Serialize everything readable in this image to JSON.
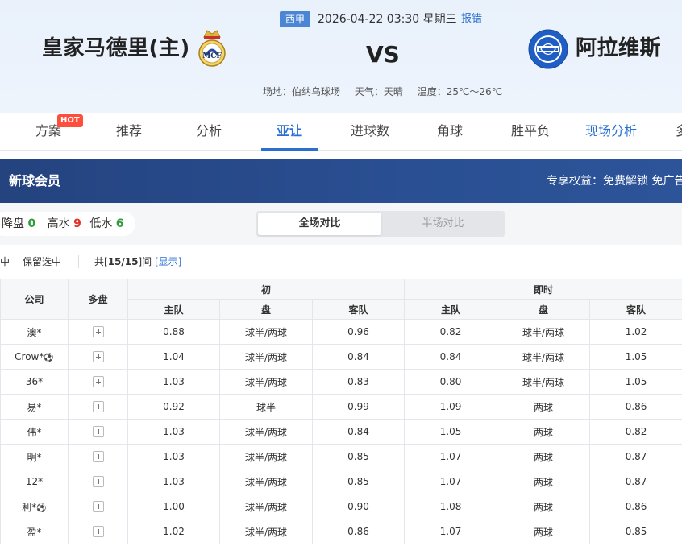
{
  "match": {
    "league": "西甲",
    "time": "2026-04-22 03:30 星期三",
    "report": "报错",
    "home": "皇家马德里(主)",
    "vs": "VS",
    "away": "阿拉维斯",
    "venue": "场地：伯纳乌球场",
    "weather": "天气：天晴",
    "temperature": "温度：25℃～26℃"
  },
  "tabs": [
    {
      "label": "方案"
    },
    {
      "label": "推荐"
    },
    {
      "label": "分析"
    },
    {
      "label": "亚让"
    },
    {
      "label": "进球数"
    },
    {
      "label": "角球"
    },
    {
      "label": "胜平负"
    },
    {
      "label": "现场分析"
    },
    {
      "label": "多"
    }
  ],
  "hot_badge": "HOT",
  "member": {
    "title": "新球会员",
    "benefit": "专享权益：免费解锁 免广告"
  },
  "stats": {
    "down_label": "降盘",
    "down_value": "0",
    "high_label": "高水",
    "high_value": "9",
    "low_label": "低水",
    "low_value": "6"
  },
  "toggle": {
    "full": "全场对比",
    "half": "半场对比"
  },
  "filter": {
    "select_label": "选中",
    "keep_label": "保留选中",
    "total_prefix": "共[",
    "total_value": "15/15",
    "total_suffix": "]间",
    "show_label": "[显示]"
  },
  "table": {
    "headers": {
      "company": "公司",
      "multi": "多盘",
      "initial": "初",
      "live": "即时",
      "home": "主队",
      "handicap": "盘",
      "away": "客队"
    },
    "rows": [
      {
        "company": "澳*",
        "ball": false,
        "i_home": "0.88",
        "i_line": "球半/两球",
        "i_away": "0.96",
        "l_home": "0.82",
        "l_line": "球半/两球",
        "l_away": "1.02"
      },
      {
        "company": "Crow*",
        "ball": true,
        "i_home": "1.04",
        "i_line": "球半/两球",
        "i_away": "0.84",
        "l_home": "0.84",
        "l_line": "球半/两球",
        "l_away": "1.05"
      },
      {
        "company": "36*",
        "ball": false,
        "i_home": "1.03",
        "i_line": "球半/两球",
        "i_away": "0.83",
        "l_home": "0.80",
        "l_line": "球半/两球",
        "l_away": "1.05"
      },
      {
        "company": "易*",
        "ball": false,
        "i_home": "0.92",
        "i_line": "球半",
        "i_away": "0.99",
        "l_home": "1.09",
        "l_line": "两球",
        "l_away": "0.86"
      },
      {
        "company": "伟*",
        "ball": false,
        "i_home": "1.03",
        "i_line": "球半/两球",
        "i_away": "0.84",
        "l_home": "1.05",
        "l_line": "两球",
        "l_away": "0.82"
      },
      {
        "company": "明*",
        "ball": false,
        "i_home": "1.03",
        "i_line": "球半/两球",
        "i_away": "0.85",
        "l_home": "1.07",
        "l_line": "两球",
        "l_away": "0.87"
      },
      {
        "company": "12*",
        "ball": false,
        "i_home": "1.03",
        "i_line": "球半/两球",
        "i_away": "0.85",
        "l_home": "1.07",
        "l_line": "两球",
        "l_away": "0.87"
      },
      {
        "company": "利*",
        "ball": true,
        "i_home": "1.00",
        "i_line": "球半/两球",
        "i_away": "0.90",
        "l_home": "1.08",
        "l_line": "两球",
        "l_away": "0.86"
      },
      {
        "company": "盈*",
        "ball": false,
        "i_home": "1.02",
        "i_line": "球半/两球",
        "i_away": "0.86",
        "l_home": "1.07",
        "l_line": "两球",
        "l_away": "0.85"
      }
    ]
  },
  "colors": {
    "accent": "#2a6fd1",
    "banner": "#24437f",
    "green": "#2e9b3e",
    "red": "#e0312a",
    "hot": "#ff4e3b"
  }
}
